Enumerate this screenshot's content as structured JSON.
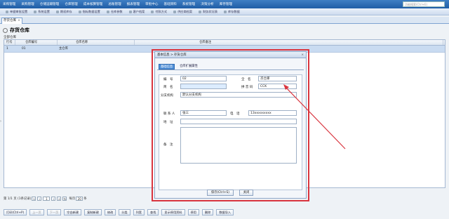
{
  "topnav": {
    "items": [
      "采购管理",
      "采购管理",
      "仓储运输管理",
      "仓库管理",
      "成本核算管理",
      "总账管理",
      "报表管理",
      "审批中心",
      "基础资料",
      "系统管理",
      "决策分析",
      "库存管理"
    ],
    "search_placeholder": "功能搜索(Ctrl+E)"
  },
  "subnav": {
    "items": [
      "单据审批设置",
      "系统设置",
      "期初库存",
      "指标数据设置",
      "仓库参数",
      "客户档案",
      "付款方式",
      "供应商档案",
      "财务状况表",
      "库存数据"
    ]
  },
  "tab": {
    "label": "存货仓库",
    "close": "×"
  },
  "page_title": "存货仓库",
  "all_warehouses": "全部仓库",
  "grid": {
    "headers": [
      "行号",
      "仓库编号",
      "仓库名称",
      "仓库备注"
    ],
    "rows": [
      {
        "row": "1",
        "code": "01",
        "name": "主仓库",
        "note": ""
      }
    ]
  },
  "pager": {
    "page_info": "第 1/1 页 (1条记录)",
    "current_page": "1",
    "per_page_label": "每页",
    "per_page": "20",
    "per_page_unit": "条"
  },
  "toolbar": {
    "buttons": [
      "打印(Ctrl+P)",
      "上一页",
      "下一页",
      "空白新建",
      "复制新建",
      "修改",
      "分类",
      "列宽",
      "查找",
      "显示停用资料",
      "停用",
      "删除",
      "数据导入"
    ]
  },
  "dialog": {
    "title": "基本信息 > 存货仓库",
    "close": "×",
    "tabs": [
      "基础信息",
      "仓库扩展属性"
    ],
    "labels": {
      "code": "编　号",
      "fullname": "全　名",
      "shortname": "简　名",
      "pinyin": "拼 音 码",
      "branch": "分支机构",
      "contact": "联 系 人",
      "phone": "电　话",
      "address": "地　址",
      "remark": "备　注"
    },
    "values": {
      "code": "02",
      "fullname": "次仓库",
      "shortname": "",
      "pinyin": "CCK",
      "branch": "默认分支机构",
      "contact": "张三",
      "phone": "13xxxxxxxxx",
      "address": "",
      "remark": ""
    },
    "save_label": "保存(Ctrl+S)",
    "close_label": "关闭"
  },
  "colors": {
    "highlight": "#d9343e",
    "accent": "#1f5da6"
  }
}
